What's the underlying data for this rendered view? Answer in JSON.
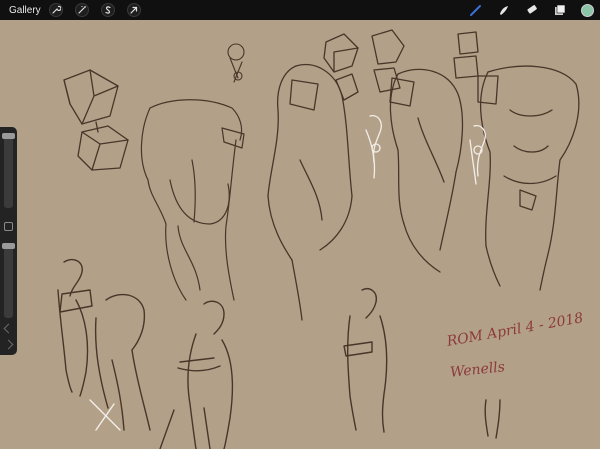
{
  "topbar": {
    "gallery_label": "Gallery",
    "left_tools": [
      {
        "icon": "wrench-icon",
        "name": "actions"
      },
      {
        "icon": "magic-wand-icon",
        "name": "adjustments"
      },
      {
        "icon": "selection-s-icon",
        "name": "selection"
      },
      {
        "icon": "arrow-cursor-icon",
        "name": "transform"
      }
    ],
    "right_tools": [
      {
        "icon": "brush-icon",
        "name": "brush",
        "active": true
      },
      {
        "icon": "smudge-icon",
        "name": "smudge"
      },
      {
        "icon": "eraser-icon",
        "name": "eraser"
      },
      {
        "icon": "layers-icon",
        "name": "layers"
      }
    ],
    "color_swatch": "#8cc4a8",
    "active_color": "#3b6fd6"
  },
  "canvas": {
    "background": "#b3a089",
    "sketch_color": "#4a3528",
    "highlight_color": "#f2efe9",
    "annotation": {
      "date_text": "ROM April 4 - 2018",
      "signature_text": "Wenells",
      "color": "#8c3a3a"
    }
  },
  "sidebar": {
    "brush_size_level": 0.92,
    "opacity_level": 0.97
  }
}
